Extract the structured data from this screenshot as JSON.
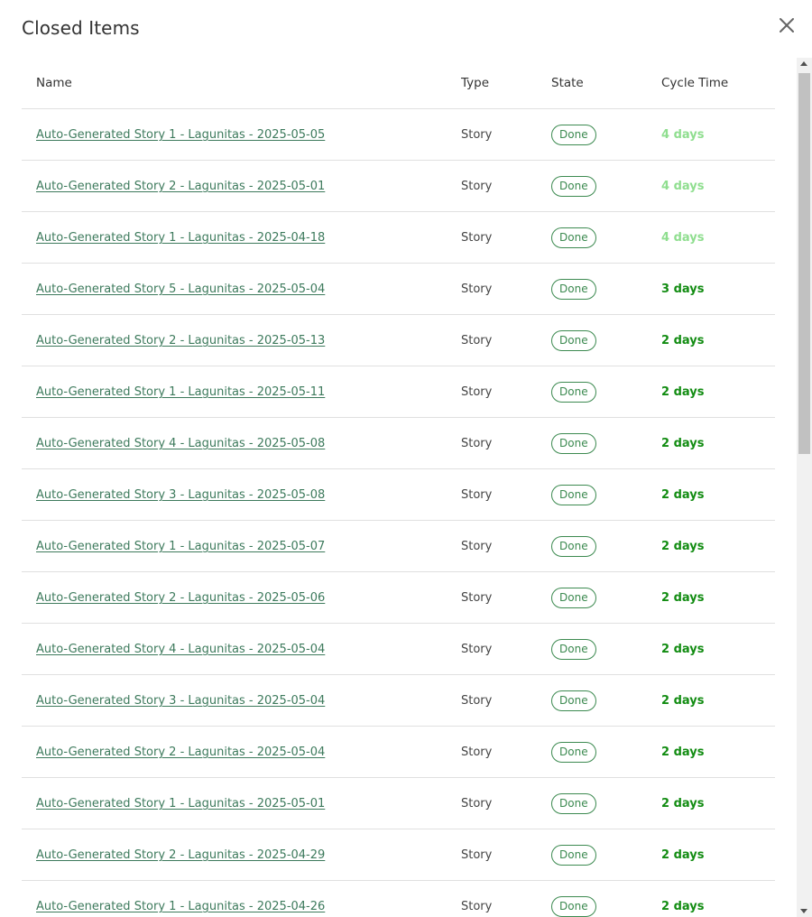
{
  "dialog": {
    "title": "Closed Items",
    "close_icon": "close-icon"
  },
  "table": {
    "columns": [
      "Name",
      "Type",
      "State",
      "Cycle Time"
    ],
    "rows": [
      {
        "name": "Auto-Generated Story 1 - Lagunitas - 2025-05-05",
        "type": "Story",
        "state": "Done",
        "cycle_time": "4 days",
        "highlight": "light"
      },
      {
        "name": "Auto-Generated Story 2 - Lagunitas - 2025-05-01",
        "type": "Story",
        "state": "Done",
        "cycle_time": "4 days",
        "highlight": "light"
      },
      {
        "name": "Auto-Generated Story 1 - Lagunitas - 2025-04-18",
        "type": "Story",
        "state": "Done",
        "cycle_time": "4 days",
        "highlight": "light"
      },
      {
        "name": "Auto-Generated Story 5 - Lagunitas - 2025-05-04",
        "type": "Story",
        "state": "Done",
        "cycle_time": "3 days",
        "highlight": "dark"
      },
      {
        "name": "Auto-Generated Story 2 - Lagunitas - 2025-05-13",
        "type": "Story",
        "state": "Done",
        "cycle_time": "2 days",
        "highlight": "dark"
      },
      {
        "name": "Auto-Generated Story 1 - Lagunitas - 2025-05-11",
        "type": "Story",
        "state": "Done",
        "cycle_time": "2 days",
        "highlight": "dark"
      },
      {
        "name": "Auto-Generated Story 4 - Lagunitas - 2025-05-08",
        "type": "Story",
        "state": "Done",
        "cycle_time": "2 days",
        "highlight": "dark"
      },
      {
        "name": "Auto-Generated Story 3 - Lagunitas - 2025-05-08",
        "type": "Story",
        "state": "Done",
        "cycle_time": "2 days",
        "highlight": "dark"
      },
      {
        "name": "Auto-Generated Story 1 - Lagunitas - 2025-05-07",
        "type": "Story",
        "state": "Done",
        "cycle_time": "2 days",
        "highlight": "dark"
      },
      {
        "name": "Auto-Generated Story 2 - Lagunitas - 2025-05-06",
        "type": "Story",
        "state": "Done",
        "cycle_time": "2 days",
        "highlight": "dark"
      },
      {
        "name": "Auto-Generated Story 4 - Lagunitas - 2025-05-04",
        "type": "Story",
        "state": "Done",
        "cycle_time": "2 days",
        "highlight": "dark"
      },
      {
        "name": "Auto-Generated Story 3 - Lagunitas - 2025-05-04",
        "type": "Story",
        "state": "Done",
        "cycle_time": "2 days",
        "highlight": "dark"
      },
      {
        "name": "Auto-Generated Story 2 - Lagunitas - 2025-05-04",
        "type": "Story",
        "state": "Done",
        "cycle_time": "2 days",
        "highlight": "dark"
      },
      {
        "name": "Auto-Generated Story 1 - Lagunitas - 2025-05-01",
        "type": "Story",
        "state": "Done",
        "cycle_time": "2 days",
        "highlight": "dark"
      },
      {
        "name": "Auto-Generated Story 2 - Lagunitas - 2025-04-29",
        "type": "Story",
        "state": "Done",
        "cycle_time": "2 days",
        "highlight": "dark"
      },
      {
        "name": "Auto-Generated Story 1 - Lagunitas - 2025-04-26",
        "type": "Story",
        "state": "Done",
        "cycle_time": "2 days",
        "highlight": "dark"
      }
    ]
  },
  "colors": {
    "link": "#3d7a5c",
    "badge": "#3c8a50",
    "cycle_light": "#8fde8f",
    "cycle_dark": "#128c12"
  }
}
